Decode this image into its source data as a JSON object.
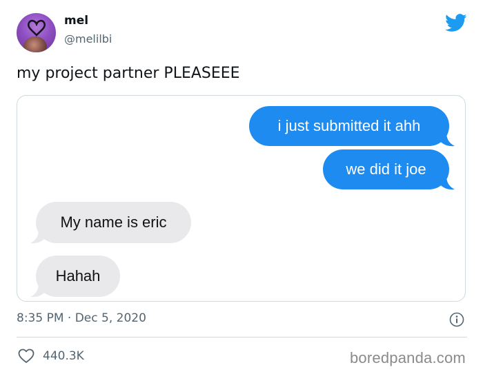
{
  "user": {
    "name": "mel",
    "handle": "@melilbi"
  },
  "tweet": {
    "text": "my project partner PLEASEEE"
  },
  "chat": {
    "messages": [
      {
        "side": "sent",
        "text": "i just submitted it ahh"
      },
      {
        "side": "sent",
        "text": "we did it joe"
      },
      {
        "side": "received",
        "text": "My name is eric"
      },
      {
        "side": "received",
        "text": "Hahah"
      }
    ]
  },
  "meta": {
    "timestamp": "8:35 PM · Dec 5, 2020"
  },
  "engagement": {
    "likes": "440.3K"
  },
  "watermark": "boredpanda.com",
  "icons": {
    "brand": "twitter-bird-icon",
    "info": "info-icon",
    "like": "heart-icon"
  },
  "colors": {
    "sent_bubble": "#1e8bf0",
    "received_bubble": "#e9e9eb",
    "twitter_blue": "#1d9bf0"
  }
}
